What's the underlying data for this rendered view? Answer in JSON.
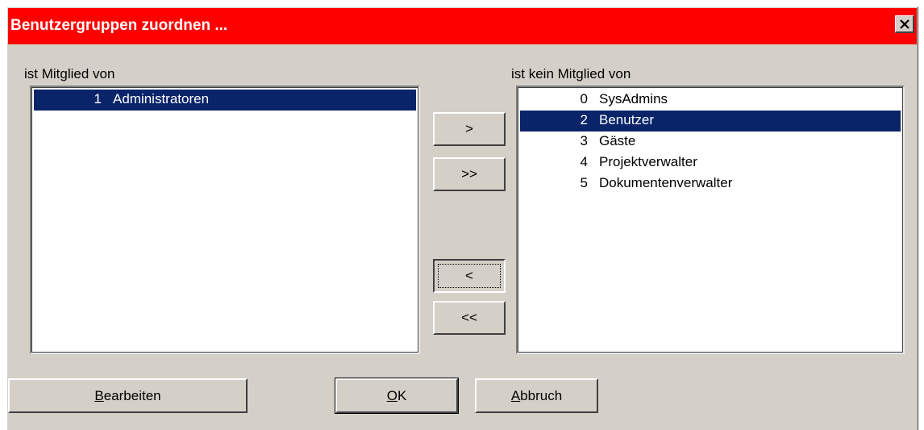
{
  "dialog": {
    "title": "Benutzergruppen zuordnen ..."
  },
  "left_list": {
    "label": "ist Mitglied von",
    "items": [
      {
        "num": "1",
        "name": "Administratoren",
        "selected": true
      }
    ]
  },
  "right_list": {
    "label": "ist kein Mitglied von",
    "items": [
      {
        "num": "0",
        "name": "SysAdmins",
        "selected": false
      },
      {
        "num": "2",
        "name": "Benutzer",
        "selected": true
      },
      {
        "num": "3",
        "name": "Gäste",
        "selected": false
      },
      {
        "num": "4",
        "name": "Projektverwalter",
        "selected": false
      },
      {
        "num": "5",
        "name": "Dokumentenverwalter",
        "selected": false
      }
    ]
  },
  "transfer_buttons": {
    "add_label": ">",
    "add_all_label": ">>",
    "remove_label": "<",
    "remove_all_label": "<<"
  },
  "buttons": {
    "edit_accel": "B",
    "edit_rest": "earbeiten",
    "ok_accel": "O",
    "ok_rest": "K",
    "cancel_accel": "A",
    "cancel_rest": "bbruch"
  },
  "colors": {
    "titlebar": "#ff0000",
    "selection": "#0a246a",
    "face": "#d4d0c8"
  }
}
